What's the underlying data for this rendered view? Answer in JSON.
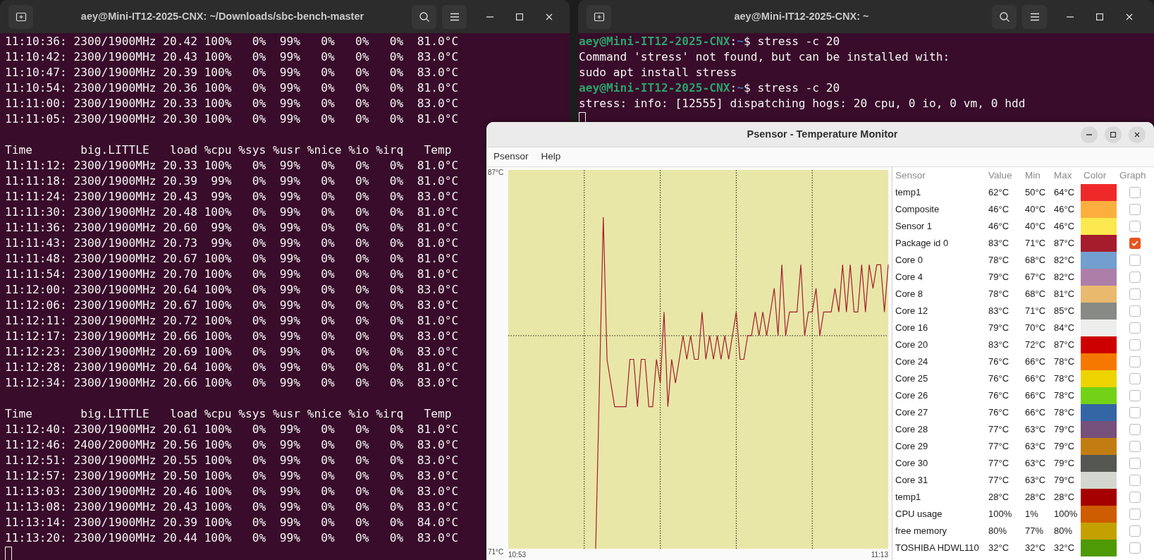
{
  "left_terminal": {
    "title": "aey@Mini-IT12-2025-CNX: ~/Downloads/sbc-bench-master",
    "groups": [
      [
        "11:10:36: 2300/1900MHz 20.42 100%   0%  99%   0%   0%   0%  81.0°C",
        "11:10:42: 2300/1900MHz 20.43 100%   0%  99%   0%   0%   0%  83.0°C",
        "11:10:47: 2300/1900MHz 20.39 100%   0%  99%   0%   0%   0%  83.0°C",
        "11:10:54: 2300/1900MHz 20.36 100%   0%  99%   0%   0%   0%  81.0°C",
        "11:11:00: 2300/1900MHz 20.33 100%   0%  99%   0%   0%   0%  83.0°C",
        "11:11:05: 2300/1900MHz 20.30 100%   0%  99%   0%   0%   0%  81.0°C"
      ],
      [
        "Time       big.LITTLE   load %cpu %sys %usr %nice %io %irq   Temp",
        "11:11:12: 2300/1900MHz 20.33 100%   0%  99%   0%   0%   0%  81.0°C",
        "11:11:18: 2300/1900MHz 20.39  99%   0%  99%   0%   0%   0%  81.0°C",
        "11:11:24: 2300/1900MHz 20.43  99%   0%  99%   0%   0%   0%  83.0°C",
        "11:11:30: 2300/1900MHz 20.48 100%   0%  99%   0%   0%   0%  81.0°C",
        "11:11:36: 2300/1900MHz 20.60  99%   0%  99%   0%   0%   0%  81.0°C",
        "11:11:43: 2300/1900MHz 20.73  99%   0%  99%   0%   0%   0%  81.0°C",
        "11:11:48: 2300/1900MHz 20.67 100%   0%  99%   0%   0%   0%  81.0°C",
        "11:11:54: 2300/1900MHz 20.70 100%   0%  99%   0%   0%   0%  81.0°C",
        "11:12:00: 2300/1900MHz 20.64 100%   0%  99%   0%   0%   0%  83.0°C",
        "11:12:06: 2300/1900MHz 20.67 100%   0%  99%   0%   0%   0%  83.0°C",
        "11:12:11: 2300/1900MHz 20.72 100%   0%  99%   0%   0%   0%  81.0°C",
        "11:12:17: 2300/1900MHz 20.66 100%   0%  99%   0%   0%   0%  83.0°C",
        "11:12:23: 2300/1900MHz 20.69 100%   0%  99%   0%   0%   0%  83.0°C",
        "11:12:28: 2300/1900MHz 20.64 100%   0%  99%   0%   0%   0%  81.0°C",
        "11:12:34: 2300/1900MHz 20.66 100%   0%  99%   0%   0%   0%  83.0°C"
      ],
      [
        "Time       big.LITTLE   load %cpu %sys %usr %nice %io %irq   Temp",
        "11:12:40: 2300/1900MHz 20.61 100%   0%  99%   0%   0%   0%  81.0°C",
        "11:12:46: 2400/2000MHz 20.56 100%   0%  99%   0%   0%   0%  83.0°C",
        "11:12:51: 2300/1900MHz 20.55 100%   0%  99%   0%   0%   0%  83.0°C",
        "11:12:57: 2300/1900MHz 20.50 100%   0%  99%   0%   0%   0%  83.0°C",
        "11:13:03: 2300/1900MHz 20.46 100%   0%  99%   0%   0%   0%  83.0°C",
        "11:13:08: 2300/1900MHz 20.43 100%   0%  99%   0%   0%   0%  83.0°C",
        "11:13:14: 2300/1900MHz 20.39 100%   0%  99%   0%   0%   0%  84.0°C",
        "11:13:20: 2300/1900MHz 20.44 100%   0%  99%   0%   0%   0%  83.0°C"
      ]
    ]
  },
  "right_terminal": {
    "title": "aey@Mini-IT12-2025-CNX: ~",
    "lines": [
      {
        "kind": "prompt",
        "user_host": "aey@Mini-IT12-2025-CNX",
        "sep": ":",
        "path": "~",
        "command": "$ stress -c 20"
      },
      {
        "kind": "output",
        "text": "Command 'stress' not found, but can be installed with:"
      },
      {
        "kind": "output",
        "text": "sudo apt install stress"
      },
      {
        "kind": "prompt",
        "user_host": "aey@Mini-IT12-2025-CNX",
        "sep": ":",
        "path": "~",
        "command": "$ stress -c 20"
      },
      {
        "kind": "output",
        "text": "stress: info: [12555] dispatching hogs: 20 cpu, 0 io, 0 vm, 0 hdd"
      }
    ]
  },
  "psensor": {
    "title": "Psensor - Temperature Monitor",
    "menu": [
      "Psensor",
      "Help"
    ],
    "chart": {
      "y_labels": [
        "87°C",
        "71°C"
      ],
      "x_labels": [
        "10:53",
        "11:13"
      ]
    },
    "table": {
      "columns": [
        "Sensor",
        "Value",
        "Min",
        "Max",
        "Color",
        "Graph"
      ],
      "rows": [
        {
          "name": "temp1",
          "value": "62°C",
          "min": "50°C",
          "max": "64°C",
          "color": "#ef2929",
          "graph": false
        },
        {
          "name": "Composite",
          "value": "46°C",
          "min": "40°C",
          "max": "46°C",
          "color": "#fcaf3e",
          "graph": false
        },
        {
          "name": "Sensor 1",
          "value": "46°C",
          "min": "40°C",
          "max": "46°C",
          "color": "#fce94f",
          "graph": false
        },
        {
          "name": "Package id 0",
          "value": "83°C",
          "min": "71°C",
          "max": "87°C",
          "color": "#a51d2d",
          "graph": true
        },
        {
          "name": "Core 0",
          "value": "78°C",
          "min": "68°C",
          "max": "82°C",
          "color": "#729fcf",
          "graph": false
        },
        {
          "name": "Core 4",
          "value": "79°C",
          "min": "67°C",
          "max": "82°C",
          "color": "#ad7fa8",
          "graph": false
        },
        {
          "name": "Core 8",
          "value": "78°C",
          "min": "68°C",
          "max": "81°C",
          "color": "#e9b96e",
          "graph": false
        },
        {
          "name": "Core 12",
          "value": "83°C",
          "min": "71°C",
          "max": "85°C",
          "color": "#888a85",
          "graph": false
        },
        {
          "name": "Core 16",
          "value": "79°C",
          "min": "70°C",
          "max": "84°C",
          "color": "#eeeeec",
          "graph": false
        },
        {
          "name": "Core 20",
          "value": "83°C",
          "min": "72°C",
          "max": "87°C",
          "color": "#cc0000",
          "graph": false
        },
        {
          "name": "Core 24",
          "value": "76°C",
          "min": "66°C",
          "max": "78°C",
          "color": "#f57900",
          "graph": false
        },
        {
          "name": "Core 25",
          "value": "76°C",
          "min": "66°C",
          "max": "78°C",
          "color": "#edd400",
          "graph": false
        },
        {
          "name": "Core 26",
          "value": "76°C",
          "min": "66°C",
          "max": "78°C",
          "color": "#73d216",
          "graph": false
        },
        {
          "name": "Core 27",
          "value": "76°C",
          "min": "66°C",
          "max": "78°C",
          "color": "#3465a4",
          "graph": false
        },
        {
          "name": "Core 28",
          "value": "77°C",
          "min": "63°C",
          "max": "79°C",
          "color": "#75507b",
          "graph": false
        },
        {
          "name": "Core 29",
          "value": "77°C",
          "min": "63°C",
          "max": "79°C",
          "color": "#c17d11",
          "graph": false
        },
        {
          "name": "Core 30",
          "value": "77°C",
          "min": "63°C",
          "max": "79°C",
          "color": "#555753",
          "graph": false
        },
        {
          "name": "Core 31",
          "value": "77°C",
          "min": "63°C",
          "max": "79°C",
          "color": "#d3d7cf",
          "graph": false
        },
        {
          "name": "temp1",
          "value": "28°C",
          "min": "28°C",
          "max": "28°C",
          "color": "#a40000",
          "graph": false
        },
        {
          "name": "CPU usage",
          "value": "100%",
          "min": "1%",
          "max": "100%",
          "color": "#ce5c00",
          "graph": false
        },
        {
          "name": "free memory",
          "value": "80%",
          "min": "77%",
          "max": "80%",
          "color": "#c4a000",
          "graph": false
        },
        {
          "name": "TOSHIBA HDWL110",
          "value": "32°C",
          "min": "32°C",
          "max": "32°C",
          "color": "#4e9a06",
          "graph": false
        }
      ]
    }
  }
}
